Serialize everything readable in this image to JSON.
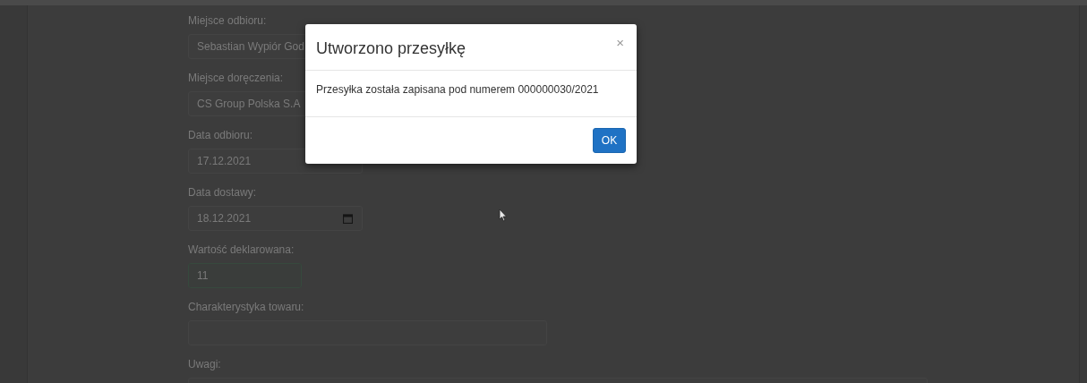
{
  "form": {
    "fields": [
      {
        "label": "Miejsce odbioru:",
        "value": "Sebastian Wypiór God",
        "kind": "text",
        "focused": false
      },
      {
        "label": "Miejsce doręczenia:",
        "value": "CS Group Polska S.A",
        "kind": "text",
        "focused": false
      },
      {
        "label": "Data odbioru:",
        "value": "17.12.2021",
        "kind": "text",
        "focused": false
      },
      {
        "label": "Data dostawy:",
        "value": "18.12.2021",
        "kind": "date",
        "focused": false
      },
      {
        "label": "Wartość deklarowana:",
        "value": "11",
        "kind": "text",
        "focused": true
      },
      {
        "label": "Charakterystyka towaru:",
        "kind": "text",
        "focused": false
      },
      {
        "label": "Uwagi:",
        "kind": "text",
        "focused": false
      }
    ]
  },
  "modal": {
    "title": "Utworzono przesyłkę",
    "close": "×",
    "message": "Przesyłka została zapisana pod numerem 000000030/2021",
    "buttons": [
      "OK"
    ]
  }
}
